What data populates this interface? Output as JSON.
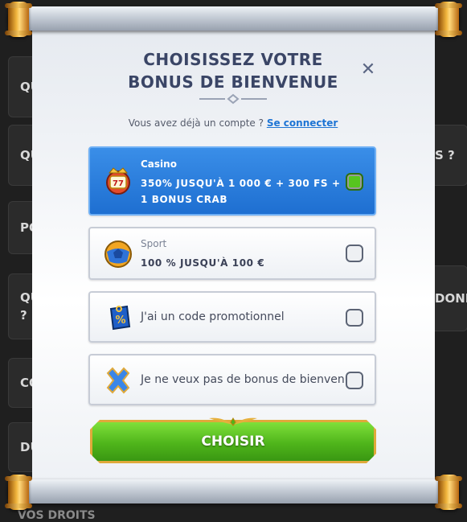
{
  "background": {
    "cards": [
      "QU",
      "QU",
      "PO",
      "QU\n?",
      "CO",
      "DU"
    ],
    "right_fragments": [
      "S ?",
      "DONN"
    ],
    "bottom_text": "VOS DROITS"
  },
  "modal": {
    "title": "CHOISISSEZ VOTRE BONUS DE BIENVENUE",
    "close_symbol": "✕",
    "account_prompt": "Vous avez déjà un compte ?",
    "login_link": "Se connecter",
    "options": [
      {
        "id": "casino",
        "label": "Casino",
        "value": "350% JUSQU'À 1 000 € + 300 FS + 1 BONUS CRAB",
        "icon": "slot-777-icon",
        "selected": true
      },
      {
        "id": "sport",
        "label": "Sport",
        "value": "100 % JUSQU'À 100 €",
        "icon": "soccer-ball-icon",
        "selected": false
      },
      {
        "id": "promo",
        "text": "J'ai un code promotionnel",
        "icon": "percent-tag-icon",
        "selected": false
      },
      {
        "id": "none",
        "text": "Je ne veux pas de bonus de bienvenue",
        "icon": "blue-x-icon",
        "selected": false
      }
    ],
    "choose_button": "CHOISIR"
  },
  "colors": {
    "title": "#3a4566",
    "selected_option": "#1e6fd1",
    "link": "#1d74d4",
    "button_green": "#4fb51b",
    "button_border": "#e0a93a",
    "checkbox_on": "#57c51f"
  }
}
